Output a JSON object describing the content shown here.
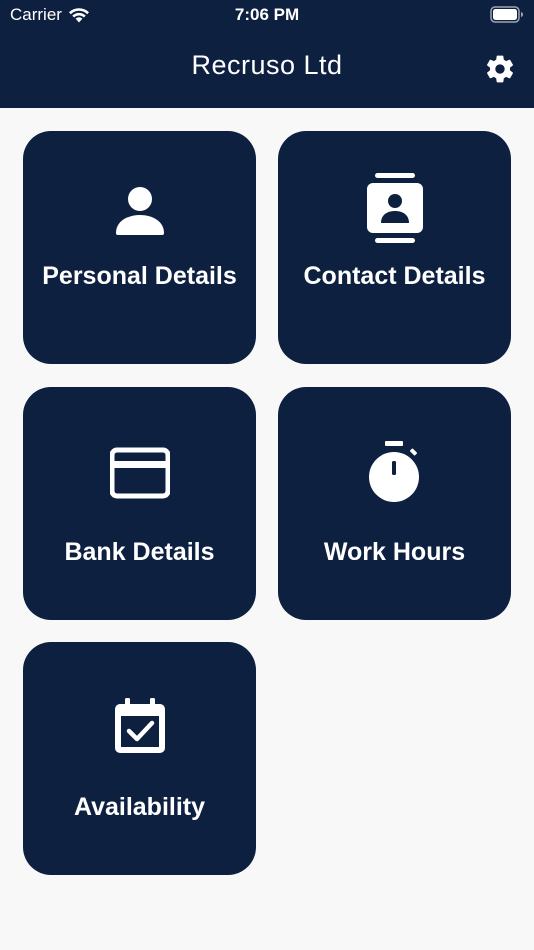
{
  "status_bar": {
    "carrier": "Carrier",
    "time": "7:06 PM"
  },
  "header": {
    "title": "Recruso Ltd",
    "settings_icon": "gear-icon"
  },
  "tiles": [
    {
      "label": "Personal Details",
      "icon": "person-icon"
    },
    {
      "label": "Contact Details",
      "icon": "contact-card-icon"
    },
    {
      "label": "Bank Details",
      "icon": "credit-card-icon"
    },
    {
      "label": "Work Hours",
      "icon": "stopwatch-icon"
    },
    {
      "label": "Availability",
      "icon": "calendar-check-icon"
    }
  ],
  "colors": {
    "brand": "#0d2040",
    "background": "#f8f8f8",
    "text_on_brand": "#ffffff"
  }
}
